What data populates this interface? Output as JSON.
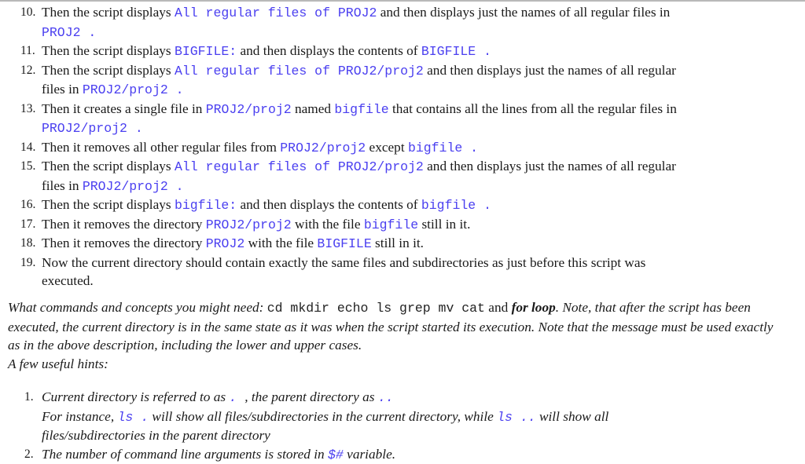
{
  "steps": [
    {
      "n": "10.",
      "parts": [
        {
          "t": "Then the script displays "
        },
        {
          "c": "All regular files of PROJ2"
        },
        {
          "t": " and then displays just the names of all regular files in"
        },
        {
          "br": true
        },
        {
          "c": "PROJ2 ."
        }
      ]
    },
    {
      "n": "11.",
      "parts": [
        {
          "t": "Then the script displays "
        },
        {
          "c": "BIGFILE:"
        },
        {
          "t": " and then displays the contents of "
        },
        {
          "c": "BIGFILE ."
        }
      ]
    },
    {
      "n": "12.",
      "parts": [
        {
          "t": "Then the script displays "
        },
        {
          "c": "All regular files of PROJ2/proj2"
        },
        {
          "t": " and then displays just the names of all regular"
        },
        {
          "br": true
        },
        {
          "t": "files in "
        },
        {
          "c": "PROJ2/proj2 ."
        }
      ]
    },
    {
      "n": "13.",
      "parts": [
        {
          "t": "Then it creates a single file in "
        },
        {
          "c": "PROJ2/proj2"
        },
        {
          "t": " named "
        },
        {
          "c": "bigfile"
        },
        {
          "t": " that contains all the lines from all the regular files in"
        },
        {
          "br": true
        },
        {
          "c": "PROJ2/proj2 ."
        }
      ]
    },
    {
      "n": "14.",
      "parts": [
        {
          "t": "Then it removes all other regular files from "
        },
        {
          "c": "PROJ2/proj2"
        },
        {
          "t": " except "
        },
        {
          "c": "bigfile ."
        }
      ]
    },
    {
      "n": "15.",
      "parts": [
        {
          "t": "Then the script displays "
        },
        {
          "c": "All regular files of PROJ2/proj2"
        },
        {
          "t": " and then displays just the names of all regular"
        },
        {
          "br": true
        },
        {
          "t": "files in "
        },
        {
          "c": "PROJ2/proj2 ."
        }
      ]
    },
    {
      "n": "16.",
      "parts": [
        {
          "t": "Then the script displays "
        },
        {
          "c": "bigfile:"
        },
        {
          "t": " and then displays the contents of "
        },
        {
          "c": "bigfile ."
        }
      ]
    },
    {
      "n": "17.",
      "parts": [
        {
          "t": "Then it removes the directory "
        },
        {
          "c": "PROJ2/proj2"
        },
        {
          "t": " with the file "
        },
        {
          "c": "bigfile"
        },
        {
          "t": " still in it."
        }
      ]
    },
    {
      "n": "18.",
      "parts": [
        {
          "t": "Then it removes the directory "
        },
        {
          "c": "PROJ2"
        },
        {
          "t": " with the file "
        },
        {
          "c": "BIGFILE"
        },
        {
          "t": " still in it."
        }
      ]
    },
    {
      "n": "19.",
      "parts": [
        {
          "t": "Now the current directory should contain exactly the same files and subdirectories as just before this script was"
        },
        {
          "br": true
        },
        {
          "t": "executed."
        }
      ]
    }
  ],
  "commands_paragraph": [
    {
      "t": "What commands and concepts you might need"
    },
    {
      "t": ": "
    },
    {
      "k": "cd mkdir echo ls grep mv cat"
    },
    {
      "n": " and "
    },
    {
      "b": "for loop"
    },
    {
      "t": ". Note, that after the script has been executed, the current directory is in the same state as it was when the script started its execution. Note that the message must be used exactly as in the above description, including the lower and upper cases."
    }
  ],
  "hints_title": "A few useful hints:",
  "hints": [
    {
      "n": "1.",
      "parts": [
        {
          "t": "Current directory is referred to as "
        },
        {
          "c": " . "
        },
        {
          "t": ", the parent directory as "
        },
        {
          "c": " .."
        },
        {
          "br": true
        },
        {
          "t": "For instance, "
        },
        {
          "c": "ls  ."
        },
        {
          "t": " will show all files/subdirectories in the current directory, while "
        },
        {
          "c": "ls  .."
        },
        {
          "t": " will show all"
        },
        {
          "br": true
        },
        {
          "t": "files/subdirectories in the parent directory"
        }
      ]
    },
    {
      "n": "2.",
      "parts": [
        {
          "t": "The number of command line arguments is stored in "
        },
        {
          "c": "$#"
        },
        {
          "t": " variable."
        }
      ]
    }
  ],
  "colors": {
    "code": "#4a3ff0",
    "text": "#1a1a1a"
  }
}
